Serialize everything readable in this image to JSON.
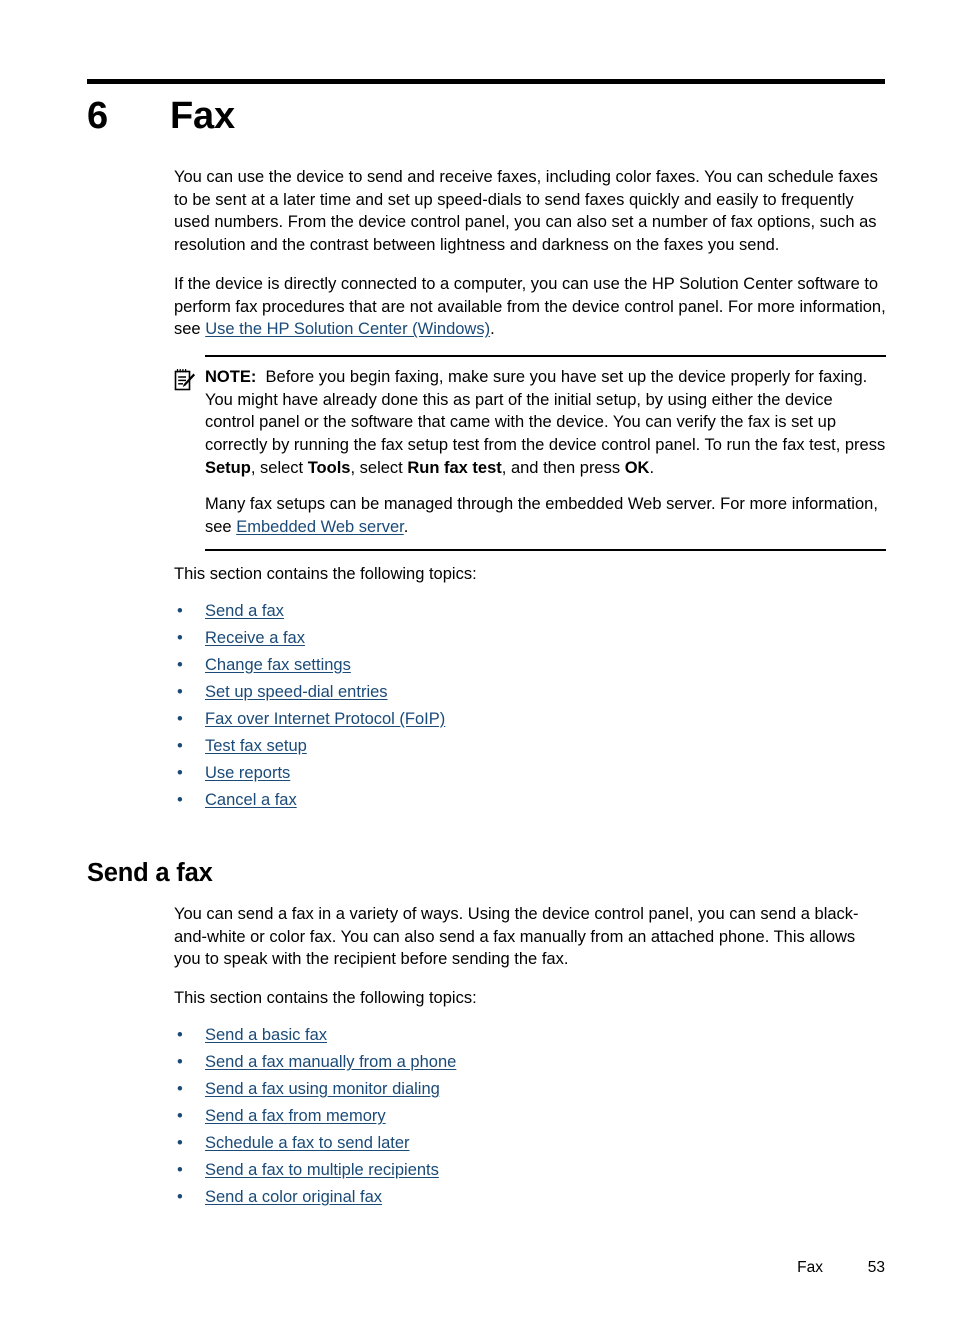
{
  "chapter": {
    "number": "6",
    "title": "Fax"
  },
  "intro": {
    "paragraph1": "You can use the device to send and receive faxes, including color faxes. You can schedule faxes to be sent at a later time and set up speed-dials to send faxes quickly and easily to frequently used numbers. From the device control panel, you can also set a number of fax options, such as resolution and the contrast between lightness and darkness on the faxes you send.",
    "paragraph2_before": "If the device is directly connected to a computer, you can use the HP Solution Center software to perform fax procedures that are not available from the device control panel. For more information, see ",
    "paragraph2_link": "Use the HP Solution Center (Windows)",
    "paragraph2_after": "."
  },
  "note": {
    "icon": "note-pencil-icon",
    "label": "NOTE:",
    "text_part1": "Before you begin faxing, make sure you have set up the device properly for faxing. You might have already done this as part of the initial setup, by using either the device control panel or the software that came with the device. You can verify the fax is set up correctly by running the fax setup test from the device control panel. To run the fax test, press ",
    "bold1": "Setup",
    "text_part2": ", select ",
    "bold2": "Tools",
    "text_part3": ", select ",
    "bold3": "Run fax test",
    "text_part4": ", and then press ",
    "bold4": "OK",
    "text_part5": ".",
    "paragraph2_before": "Many fax setups can be managed through the embedded Web server. For more information, see ",
    "paragraph2_link": "Embedded Web server",
    "paragraph2_after": "."
  },
  "topics_intro": "This section contains the following topics:",
  "chapter_topics": [
    "Send a fax",
    "Receive a fax",
    "Change fax settings",
    "Set up speed-dial entries",
    "Fax over Internet Protocol (FoIP)",
    "Test fax setup",
    "Use reports",
    "Cancel a fax"
  ],
  "section": {
    "heading": "Send a fax",
    "paragraph1": "You can send a fax in a variety of ways. Using the device control panel, you can send a black-and-white or color fax. You can also send a fax manually from an attached phone. This allows you to speak with the recipient before sending the fax.",
    "topics_intro": "This section contains the following topics:",
    "topics": [
      "Send a basic fax",
      "Send a fax manually from a phone",
      "Send a fax using monitor dialing",
      "Send a fax from memory",
      "Schedule a fax to send later",
      "Send a fax to multiple recipients",
      "Send a color original fax"
    ]
  },
  "footer": {
    "label": "Fax",
    "page": "53"
  },
  "bullet_glyph": "•",
  "colors": {
    "link": "#1a4a78",
    "text": "#000000",
    "rule": "#000000"
  }
}
